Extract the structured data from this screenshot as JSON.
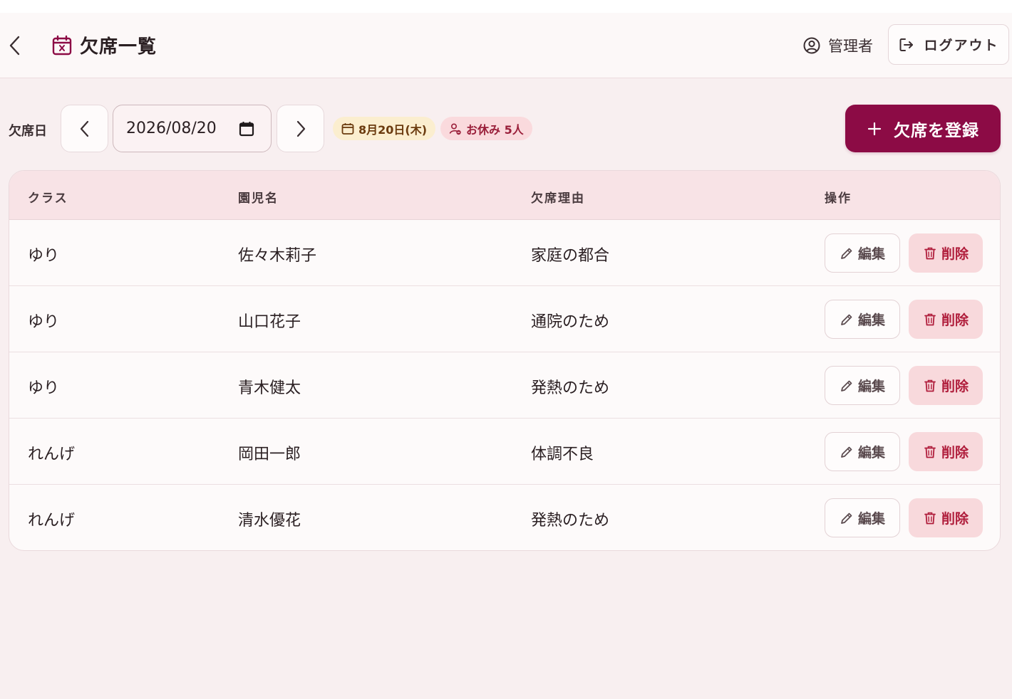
{
  "header": {
    "title": "欠席一覧",
    "user_name": "管理者",
    "logout_label": "ログアウト"
  },
  "toolbar": {
    "date_label": "欠席日",
    "date_value": "2026/08/20",
    "date_chip": "8月20日(木)",
    "absent_chip": "お休み 5人",
    "register_label": "欠席を登録"
  },
  "table": {
    "columns": [
      "クラス",
      "園児名",
      "欠席理由",
      "操作"
    ],
    "edit_label": "編集",
    "delete_label": "削除",
    "rows": [
      {
        "class": "ゆり",
        "name": "佐々木莉子",
        "reason": "家庭の都合"
      },
      {
        "class": "ゆり",
        "name": "山口花子",
        "reason": "通院のため"
      },
      {
        "class": "ゆり",
        "name": "青木健太",
        "reason": "発熱のため"
      },
      {
        "class": "れんげ",
        "name": "岡田一郎",
        "reason": "体調不良"
      },
      {
        "class": "れんげ",
        "name": "清水優花",
        "reason": "発熱のため"
      }
    ]
  },
  "colors": {
    "accent": "#8c0b45",
    "date_chip_bg": "#fbeecf",
    "absent_chip_bg": "#fadadd",
    "delete_bg": "#f8d9dc",
    "delete_text": "#b01e3c"
  },
  "icons": {
    "back": "chevron-left-icon",
    "title": "calendar-x-icon",
    "user": "user-circle-icon",
    "logout": "logout-icon",
    "prev": "chevron-left-icon",
    "next": "chevron-right-icon",
    "picker": "calendar-icon",
    "chip_date": "calendar-icon",
    "chip_absent": "user-minus-icon",
    "register": "plus-icon",
    "edit": "pencil-icon",
    "delete": "trash-icon"
  }
}
